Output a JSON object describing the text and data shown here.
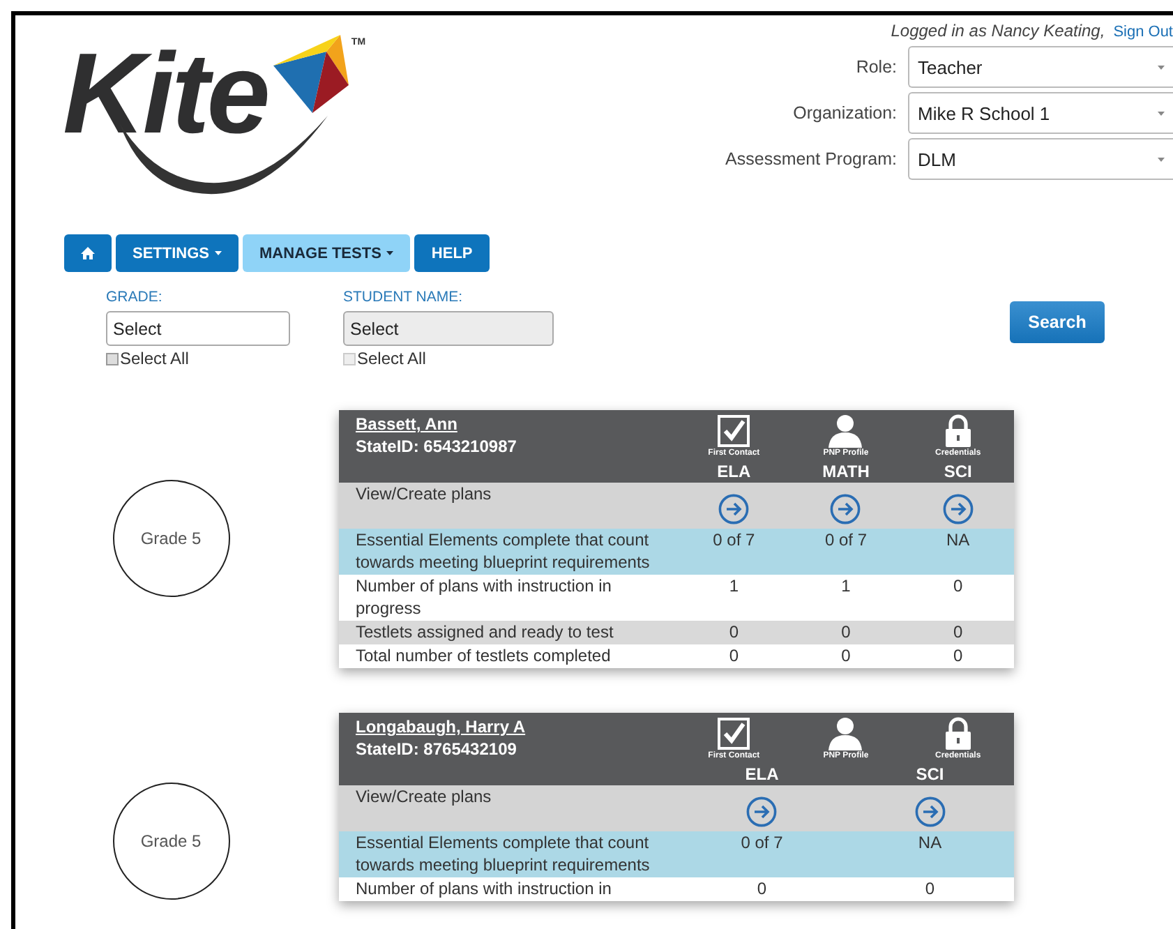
{
  "header": {
    "logo": "Kite",
    "trademark": "TM",
    "logged_in": "Logged in as Nancy Keating,",
    "sign_out": "Sign Out",
    "selects": [
      {
        "label": "Role:",
        "value": "Teacher"
      },
      {
        "label": "Organization:",
        "value": "Mike R School 1"
      },
      {
        "label": "Assessment Program:",
        "value": "DLM"
      }
    ]
  },
  "nav": [
    {
      "kind": "home",
      "selected": false
    },
    {
      "kind": "menu",
      "label": "SETTINGS",
      "selected": false
    },
    {
      "kind": "menu",
      "label": "MANAGE TESTS",
      "selected": true
    },
    {
      "kind": "link",
      "label": "HELP",
      "selected": false
    }
  ],
  "filters": [
    {
      "label": "GRADE:",
      "placeholder": "Select",
      "select_all": "Select All",
      "checked": false,
      "disabled": false
    },
    {
      "label": "STUDENT NAME:",
      "placeholder": "Select",
      "select_all": "Select All",
      "checked": false,
      "disabled": true
    }
  ],
  "search_button": "Search",
  "students": [
    {
      "grade": "Grade 5",
      "name": "Bassett, Ann",
      "state_id": "StateID: 6543210987",
      "status": [
        {
          "kind": "check",
          "label": "First Contact"
        },
        {
          "kind": "person",
          "label": "PNP Profile"
        },
        {
          "kind": "lock",
          "label": "Credentials"
        }
      ],
      "subjects": [
        "ELA",
        "MATH",
        "SCI"
      ],
      "rows": [
        {
          "kind": "link",
          "label": "View/Create plans"
        },
        {
          "kind": "highlight",
          "label": "Essential Elements complete that count towards meeting blueprint requirements",
          "values": [
            "0 of 7",
            "0 of 7",
            "NA"
          ]
        },
        {
          "kind": "plain",
          "label": "Number of plans with instruction in progress",
          "values": [
            "1",
            "1",
            "0"
          ]
        },
        {
          "kind": "shaded",
          "label": "Testlets assigned and ready to test",
          "values": [
            "0",
            "0",
            "0"
          ]
        },
        {
          "kind": "plain",
          "label": "Total number of testlets completed",
          "values": [
            "0",
            "0",
            "0"
          ]
        }
      ]
    },
    {
      "grade": "Grade 5",
      "name": "Longabaugh, Harry A",
      "state_id": "StateID: 8765432109",
      "status": [
        {
          "kind": "check",
          "label": "First Contact"
        },
        {
          "kind": "person",
          "label": "PNP Profile"
        },
        {
          "kind": "lock",
          "label": "Credentials"
        }
      ],
      "subjects": [
        "ELA",
        "SCI"
      ],
      "rows": [
        {
          "kind": "link",
          "label": "View/Create plans"
        },
        {
          "kind": "highlight",
          "label": "Essential Elements complete that count towards meeting blueprint requirements",
          "values": [
            "0 of 7",
            "NA"
          ]
        },
        {
          "kind": "plain",
          "label": "Number of plans with instruction in",
          "values": [
            "0",
            "0"
          ]
        }
      ]
    }
  ]
}
